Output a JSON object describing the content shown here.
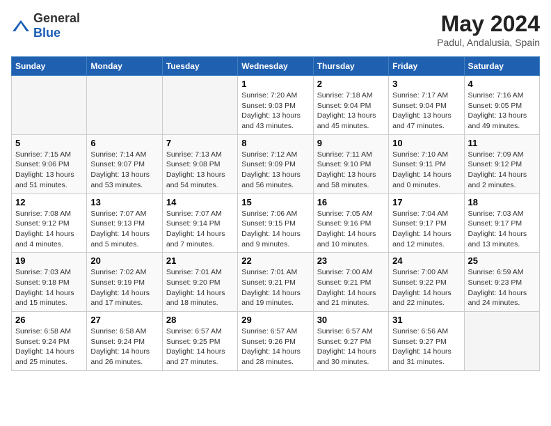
{
  "header": {
    "logo_general": "General",
    "logo_blue": "Blue",
    "month_year": "May 2024",
    "location": "Padul, Andalusia, Spain"
  },
  "weekdays": [
    "Sunday",
    "Monday",
    "Tuesday",
    "Wednesday",
    "Thursday",
    "Friday",
    "Saturday"
  ],
  "weeks": [
    [
      {
        "day": "",
        "empty": true
      },
      {
        "day": "",
        "empty": true
      },
      {
        "day": "",
        "empty": true
      },
      {
        "day": "1",
        "sunrise": "Sunrise: 7:20 AM",
        "sunset": "Sunset: 9:03 PM",
        "daylight": "Daylight: 13 hours and 43 minutes."
      },
      {
        "day": "2",
        "sunrise": "Sunrise: 7:18 AM",
        "sunset": "Sunset: 9:04 PM",
        "daylight": "Daylight: 13 hours and 45 minutes."
      },
      {
        "day": "3",
        "sunrise": "Sunrise: 7:17 AM",
        "sunset": "Sunset: 9:04 PM",
        "daylight": "Daylight: 13 hours and 47 minutes."
      },
      {
        "day": "4",
        "sunrise": "Sunrise: 7:16 AM",
        "sunset": "Sunset: 9:05 PM",
        "daylight": "Daylight: 13 hours and 49 minutes."
      }
    ],
    [
      {
        "day": "5",
        "sunrise": "Sunrise: 7:15 AM",
        "sunset": "Sunset: 9:06 PM",
        "daylight": "Daylight: 13 hours and 51 minutes."
      },
      {
        "day": "6",
        "sunrise": "Sunrise: 7:14 AM",
        "sunset": "Sunset: 9:07 PM",
        "daylight": "Daylight: 13 hours and 53 minutes."
      },
      {
        "day": "7",
        "sunrise": "Sunrise: 7:13 AM",
        "sunset": "Sunset: 9:08 PM",
        "daylight": "Daylight: 13 hours and 54 minutes."
      },
      {
        "day": "8",
        "sunrise": "Sunrise: 7:12 AM",
        "sunset": "Sunset: 9:09 PM",
        "daylight": "Daylight: 13 hours and 56 minutes."
      },
      {
        "day": "9",
        "sunrise": "Sunrise: 7:11 AM",
        "sunset": "Sunset: 9:10 PM",
        "daylight": "Daylight: 13 hours and 58 minutes."
      },
      {
        "day": "10",
        "sunrise": "Sunrise: 7:10 AM",
        "sunset": "Sunset: 9:11 PM",
        "daylight": "Daylight: 14 hours and 0 minutes."
      },
      {
        "day": "11",
        "sunrise": "Sunrise: 7:09 AM",
        "sunset": "Sunset: 9:12 PM",
        "daylight": "Daylight: 14 hours and 2 minutes."
      }
    ],
    [
      {
        "day": "12",
        "sunrise": "Sunrise: 7:08 AM",
        "sunset": "Sunset: 9:12 PM",
        "daylight": "Daylight: 14 hours and 4 minutes."
      },
      {
        "day": "13",
        "sunrise": "Sunrise: 7:07 AM",
        "sunset": "Sunset: 9:13 PM",
        "daylight": "Daylight: 14 hours and 5 minutes."
      },
      {
        "day": "14",
        "sunrise": "Sunrise: 7:07 AM",
        "sunset": "Sunset: 9:14 PM",
        "daylight": "Daylight: 14 hours and 7 minutes."
      },
      {
        "day": "15",
        "sunrise": "Sunrise: 7:06 AM",
        "sunset": "Sunset: 9:15 PM",
        "daylight": "Daylight: 14 hours and 9 minutes."
      },
      {
        "day": "16",
        "sunrise": "Sunrise: 7:05 AM",
        "sunset": "Sunset: 9:16 PM",
        "daylight": "Daylight: 14 hours and 10 minutes."
      },
      {
        "day": "17",
        "sunrise": "Sunrise: 7:04 AM",
        "sunset": "Sunset: 9:17 PM",
        "daylight": "Daylight: 14 hours and 12 minutes."
      },
      {
        "day": "18",
        "sunrise": "Sunrise: 7:03 AM",
        "sunset": "Sunset: 9:17 PM",
        "daylight": "Daylight: 14 hours and 13 minutes."
      }
    ],
    [
      {
        "day": "19",
        "sunrise": "Sunrise: 7:03 AM",
        "sunset": "Sunset: 9:18 PM",
        "daylight": "Daylight: 14 hours and 15 minutes."
      },
      {
        "day": "20",
        "sunrise": "Sunrise: 7:02 AM",
        "sunset": "Sunset: 9:19 PM",
        "daylight": "Daylight: 14 hours and 17 minutes."
      },
      {
        "day": "21",
        "sunrise": "Sunrise: 7:01 AM",
        "sunset": "Sunset: 9:20 PM",
        "daylight": "Daylight: 14 hours and 18 minutes."
      },
      {
        "day": "22",
        "sunrise": "Sunrise: 7:01 AM",
        "sunset": "Sunset: 9:21 PM",
        "daylight": "Daylight: 14 hours and 19 minutes."
      },
      {
        "day": "23",
        "sunrise": "Sunrise: 7:00 AM",
        "sunset": "Sunset: 9:21 PM",
        "daylight": "Daylight: 14 hours and 21 minutes."
      },
      {
        "day": "24",
        "sunrise": "Sunrise: 7:00 AM",
        "sunset": "Sunset: 9:22 PM",
        "daylight": "Daylight: 14 hours and 22 minutes."
      },
      {
        "day": "25",
        "sunrise": "Sunrise: 6:59 AM",
        "sunset": "Sunset: 9:23 PM",
        "daylight": "Daylight: 14 hours and 24 minutes."
      }
    ],
    [
      {
        "day": "26",
        "sunrise": "Sunrise: 6:58 AM",
        "sunset": "Sunset: 9:24 PM",
        "daylight": "Daylight: 14 hours and 25 minutes."
      },
      {
        "day": "27",
        "sunrise": "Sunrise: 6:58 AM",
        "sunset": "Sunset: 9:24 PM",
        "daylight": "Daylight: 14 hours and 26 minutes."
      },
      {
        "day": "28",
        "sunrise": "Sunrise: 6:57 AM",
        "sunset": "Sunset: 9:25 PM",
        "daylight": "Daylight: 14 hours and 27 minutes."
      },
      {
        "day": "29",
        "sunrise": "Sunrise: 6:57 AM",
        "sunset": "Sunset: 9:26 PM",
        "daylight": "Daylight: 14 hours and 28 minutes."
      },
      {
        "day": "30",
        "sunrise": "Sunrise: 6:57 AM",
        "sunset": "Sunset: 9:27 PM",
        "daylight": "Daylight: 14 hours and 30 minutes."
      },
      {
        "day": "31",
        "sunrise": "Sunrise: 6:56 AM",
        "sunset": "Sunset: 9:27 PM",
        "daylight": "Daylight: 14 hours and 31 minutes."
      },
      {
        "day": "",
        "empty": true
      }
    ]
  ]
}
